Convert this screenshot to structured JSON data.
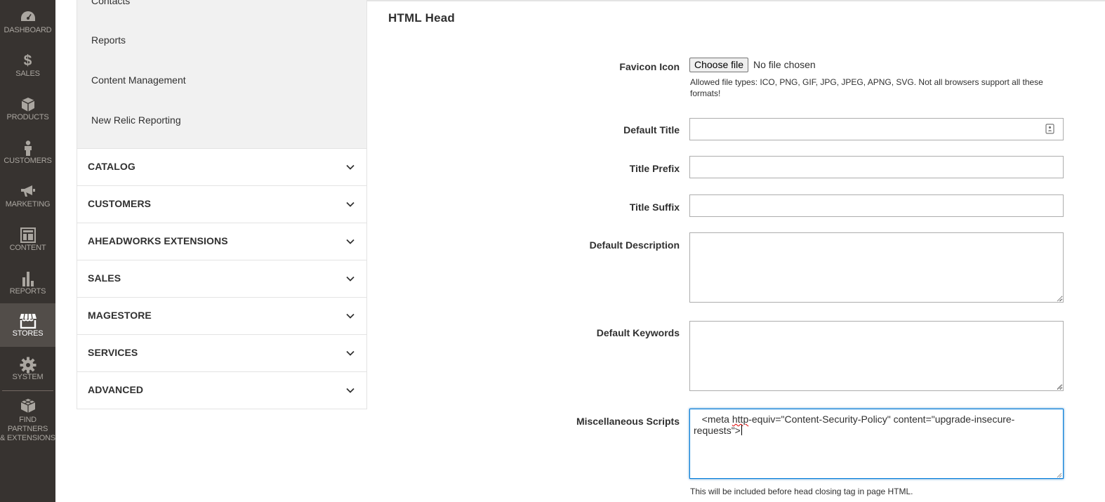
{
  "nav": {
    "items": [
      {
        "id": "dashboard",
        "label": "DASHBOARD",
        "icon": "dashboard-icon"
      },
      {
        "id": "sales",
        "label": "SALES",
        "icon": "dollar-icon"
      },
      {
        "id": "products",
        "label": "PRODUCTS",
        "icon": "box-icon"
      },
      {
        "id": "customers",
        "label": "CUSTOMERS",
        "icon": "person-icon"
      },
      {
        "id": "marketing",
        "label": "MARKETING",
        "icon": "megaphone-icon"
      },
      {
        "id": "content",
        "label": "CONTENT",
        "icon": "layout-icon"
      },
      {
        "id": "reports",
        "label": "REPORTS",
        "icon": "bar-chart-icon"
      },
      {
        "id": "stores",
        "label": "STORES",
        "icon": "storefront-icon"
      },
      {
        "id": "system",
        "label": "SYSTEM",
        "icon": "gear-icon"
      },
      {
        "id": "partners",
        "label": "FIND PARTNERS\n& EXTENSIONS",
        "icon": "blocks-icon"
      }
    ],
    "active": "stores"
  },
  "config_tabs": {
    "sub_items": [
      "Contacts",
      "Reports",
      "Content Management",
      "New Relic Reporting"
    ],
    "groups": [
      "CATALOG",
      "CUSTOMERS",
      "AHEADWORKS EXTENSIONS",
      "SALES",
      "MAGESTORE",
      "SERVICES",
      "ADVANCED"
    ]
  },
  "section": {
    "title": "HTML Head",
    "favicon": {
      "label": "Favicon Icon",
      "button": "Choose file",
      "status": "No file chosen",
      "note": "Allowed file types: ICO, PNG, GIF, JPG, JPEG, APNG, SVG. Not all browsers support all these formats!"
    },
    "default_title": {
      "label": "Default Title",
      "value": ""
    },
    "title_prefix": {
      "label": "Title Prefix",
      "value": ""
    },
    "title_suffix": {
      "label": "Title Suffix",
      "value": ""
    },
    "default_description": {
      "label": "Default Description",
      "value": ""
    },
    "default_keywords": {
      "label": "Default Keywords",
      "value": ""
    },
    "misc_scripts": {
      "label": "Miscellaneous Scripts",
      "value_pre": "   <meta ",
      "value_spell": "http",
      "value_post": "-equiv=\"Content-Security-Policy\" content=\"upgrade-insecure-requests\">",
      "note": "This will be included before head closing tag in page HTML."
    }
  },
  "colors": {
    "nav_bg": "#373330",
    "nav_active": "#524d49",
    "focus_border": "#007bdb"
  }
}
